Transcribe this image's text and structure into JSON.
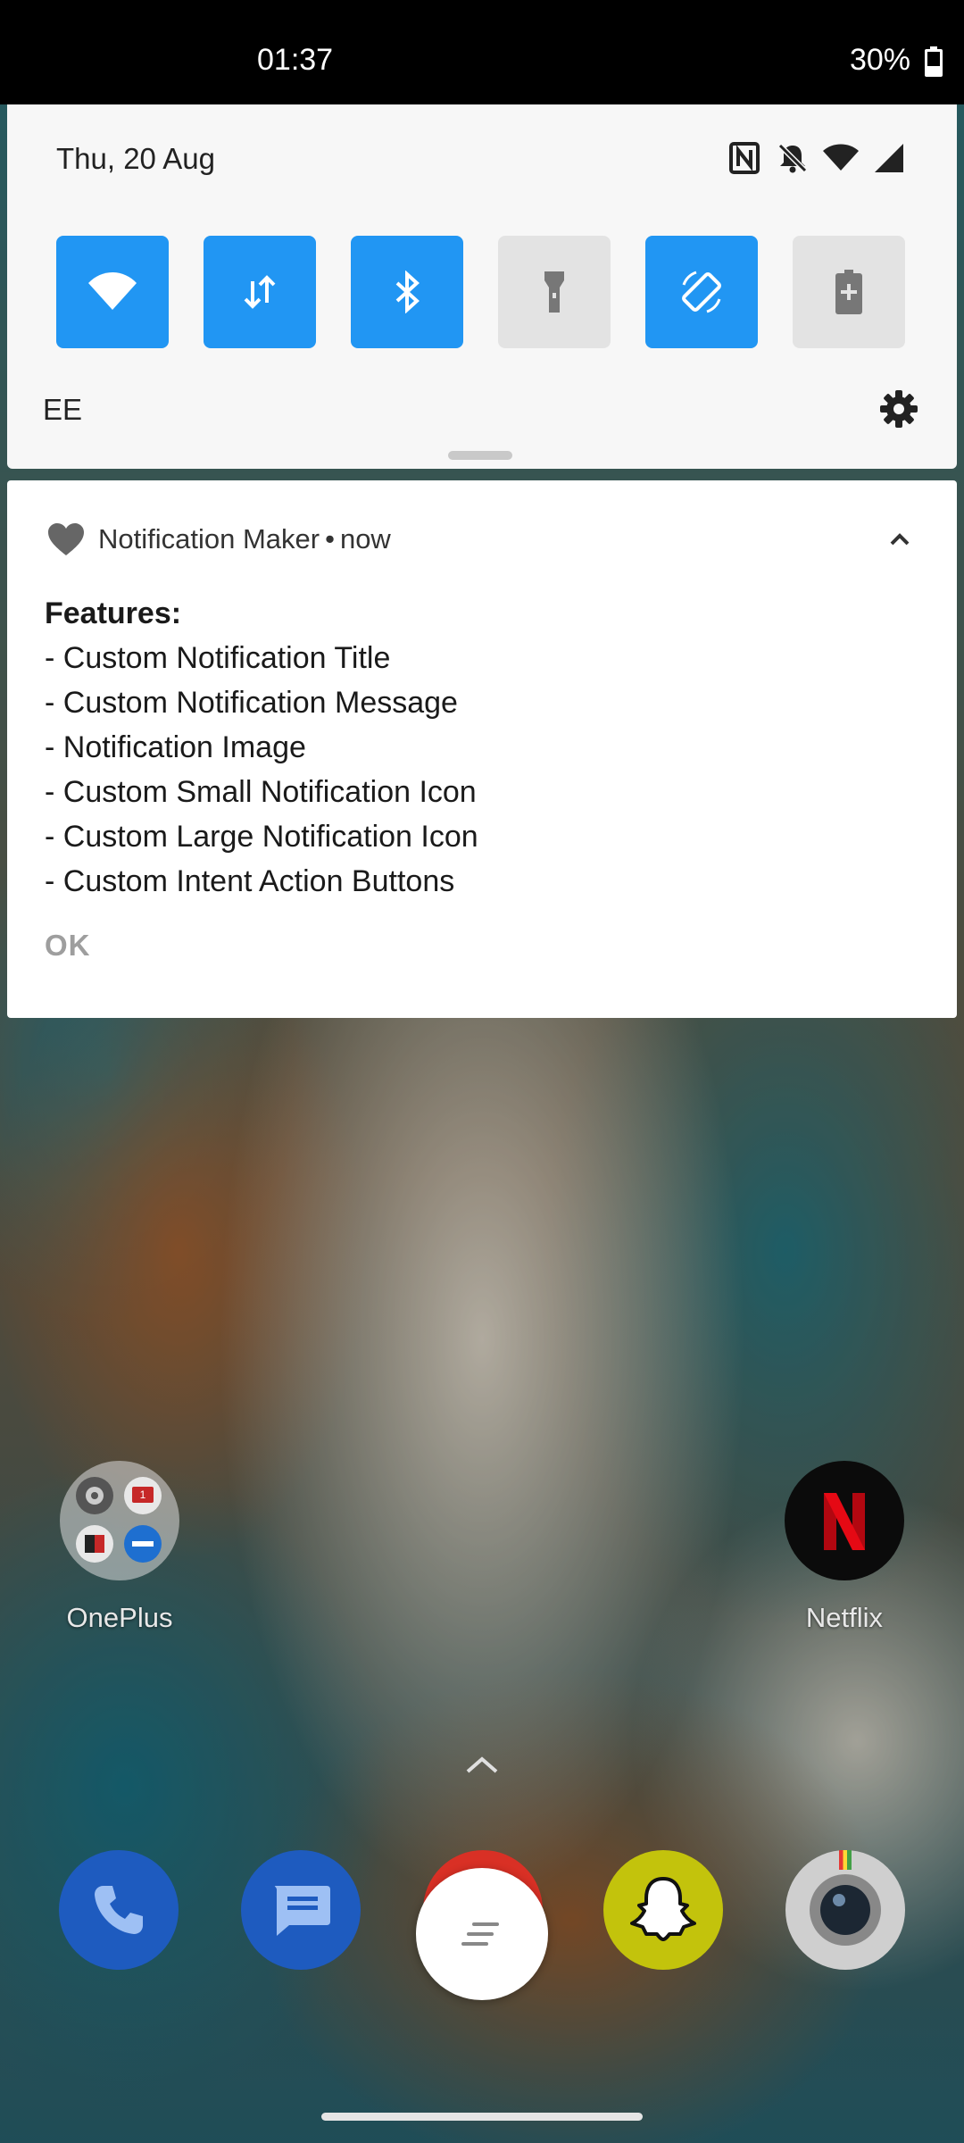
{
  "status_bar": {
    "time": "01:37",
    "battery": "30%"
  },
  "quick_settings": {
    "date": "Thu, 20 Aug",
    "carrier": "EE",
    "tiles": [
      {
        "name": "wifi",
        "state": "on"
      },
      {
        "name": "mobile-data",
        "state": "on"
      },
      {
        "name": "bluetooth",
        "state": "on"
      },
      {
        "name": "flashlight",
        "state": "off"
      },
      {
        "name": "auto-rotate",
        "state": "on"
      },
      {
        "name": "battery-saver",
        "state": "off"
      }
    ],
    "colors": {
      "tile_on": "#2196f3",
      "tile_off": "#e3e3e3"
    }
  },
  "notification": {
    "app_name": "Notification Maker",
    "separator": "•",
    "time": "now",
    "title": "Features:",
    "lines": [
      "- Custom Notification Title",
      "- Custom Notification Message",
      "- Notification Image",
      "- Custom Small Notification Icon",
      "- Custom Large Notification Icon",
      "- Custom Intent Action Buttons"
    ],
    "action": "OK"
  },
  "home": {
    "folder_label": "OnePlus",
    "folder_badge": "1",
    "netflix_label": "Netflix",
    "dock": [
      "phone",
      "messages",
      "chrome",
      "snapchat",
      "camera"
    ]
  }
}
